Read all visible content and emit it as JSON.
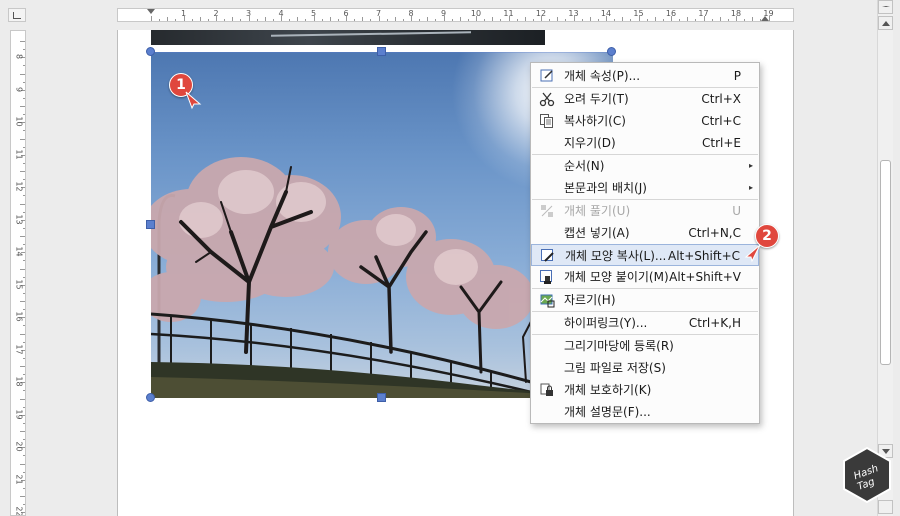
{
  "ruler": {
    "h_numbers": [
      "1",
      "2",
      "3",
      "4",
      "5",
      "6",
      "7",
      "8",
      "9",
      "10",
      "11",
      "12",
      "13",
      "14",
      "15",
      "16",
      "17",
      "18",
      "19"
    ],
    "v_numbers": [
      "8",
      "9",
      "10",
      "11",
      "12",
      "13",
      "14",
      "15",
      "16",
      "17",
      "18",
      "19",
      "20",
      "21",
      "22"
    ]
  },
  "badges": {
    "one": "1",
    "two": "2"
  },
  "context_menu": {
    "items": [
      {
        "label": "개체 속성(P)...",
        "shortcut": "P",
        "icon": "properties-icon",
        "submenu": false,
        "disabled": false,
        "highlighted": false
      },
      {
        "separator": true
      },
      {
        "label": "오려 두기(T)",
        "shortcut": "Ctrl+X",
        "icon": "scissors-icon",
        "submenu": false,
        "disabled": false,
        "highlighted": false
      },
      {
        "label": "복사하기(C)",
        "shortcut": "Ctrl+C",
        "icon": "copy-icon",
        "submenu": false,
        "disabled": false,
        "highlighted": false
      },
      {
        "label": "지우기(D)",
        "shortcut": "Ctrl+E",
        "icon": "",
        "submenu": false,
        "disabled": false,
        "highlighted": false
      },
      {
        "separator": true
      },
      {
        "label": "순서(N)",
        "shortcut": "",
        "icon": "",
        "submenu": true,
        "disabled": false,
        "highlighted": false
      },
      {
        "label": "본문과의 배치(J)",
        "shortcut": "",
        "icon": "",
        "submenu": true,
        "disabled": false,
        "highlighted": false
      },
      {
        "separator": true
      },
      {
        "label": "개체 풀기(U)",
        "shortcut": "U",
        "icon": "ungroup-icon",
        "submenu": false,
        "disabled": true,
        "highlighted": false
      },
      {
        "label": "캡션 넣기(A)",
        "shortcut": "Ctrl+N,C",
        "icon": "",
        "submenu": false,
        "disabled": false,
        "highlighted": false
      },
      {
        "label": "개체 모양 복사(L)...",
        "shortcut": "Alt+Shift+C",
        "icon": "copy-format-icon",
        "submenu": false,
        "disabled": false,
        "highlighted": true
      },
      {
        "label": "개체 모양 붙이기(M)",
        "shortcut": "Alt+Shift+V",
        "icon": "paste-format-icon",
        "submenu": false,
        "disabled": false,
        "highlighted": false
      },
      {
        "separator": true
      },
      {
        "label": "자르기(H)",
        "shortcut": "",
        "icon": "crop-icon",
        "submenu": false,
        "disabled": false,
        "highlighted": false
      },
      {
        "separator": true
      },
      {
        "label": "하이퍼링크(Y)...",
        "shortcut": "Ctrl+K,H",
        "icon": "",
        "submenu": false,
        "disabled": false,
        "highlighted": false
      },
      {
        "separator": true
      },
      {
        "label": "그리기마당에 등록(R)",
        "shortcut": "",
        "icon": "",
        "submenu": false,
        "disabled": false,
        "highlighted": false
      },
      {
        "label": "그림 파일로 저장(S)",
        "shortcut": "",
        "icon": "",
        "submenu": false,
        "disabled": false,
        "highlighted": false
      },
      {
        "label": "개체 보호하기(K)",
        "shortcut": "",
        "icon": "lock-icon",
        "submenu": false,
        "disabled": false,
        "highlighted": false
      },
      {
        "label": "개체 설명문(F)...",
        "shortcut": "",
        "icon": "",
        "submenu": false,
        "disabled": false,
        "highlighted": false
      }
    ]
  },
  "logo": {
    "line1": "Hash",
    "line2": "Tag"
  },
  "colors": {
    "accent": "#5b7fce",
    "badge": "#e0473d",
    "highlight": "#dfe8f6"
  }
}
